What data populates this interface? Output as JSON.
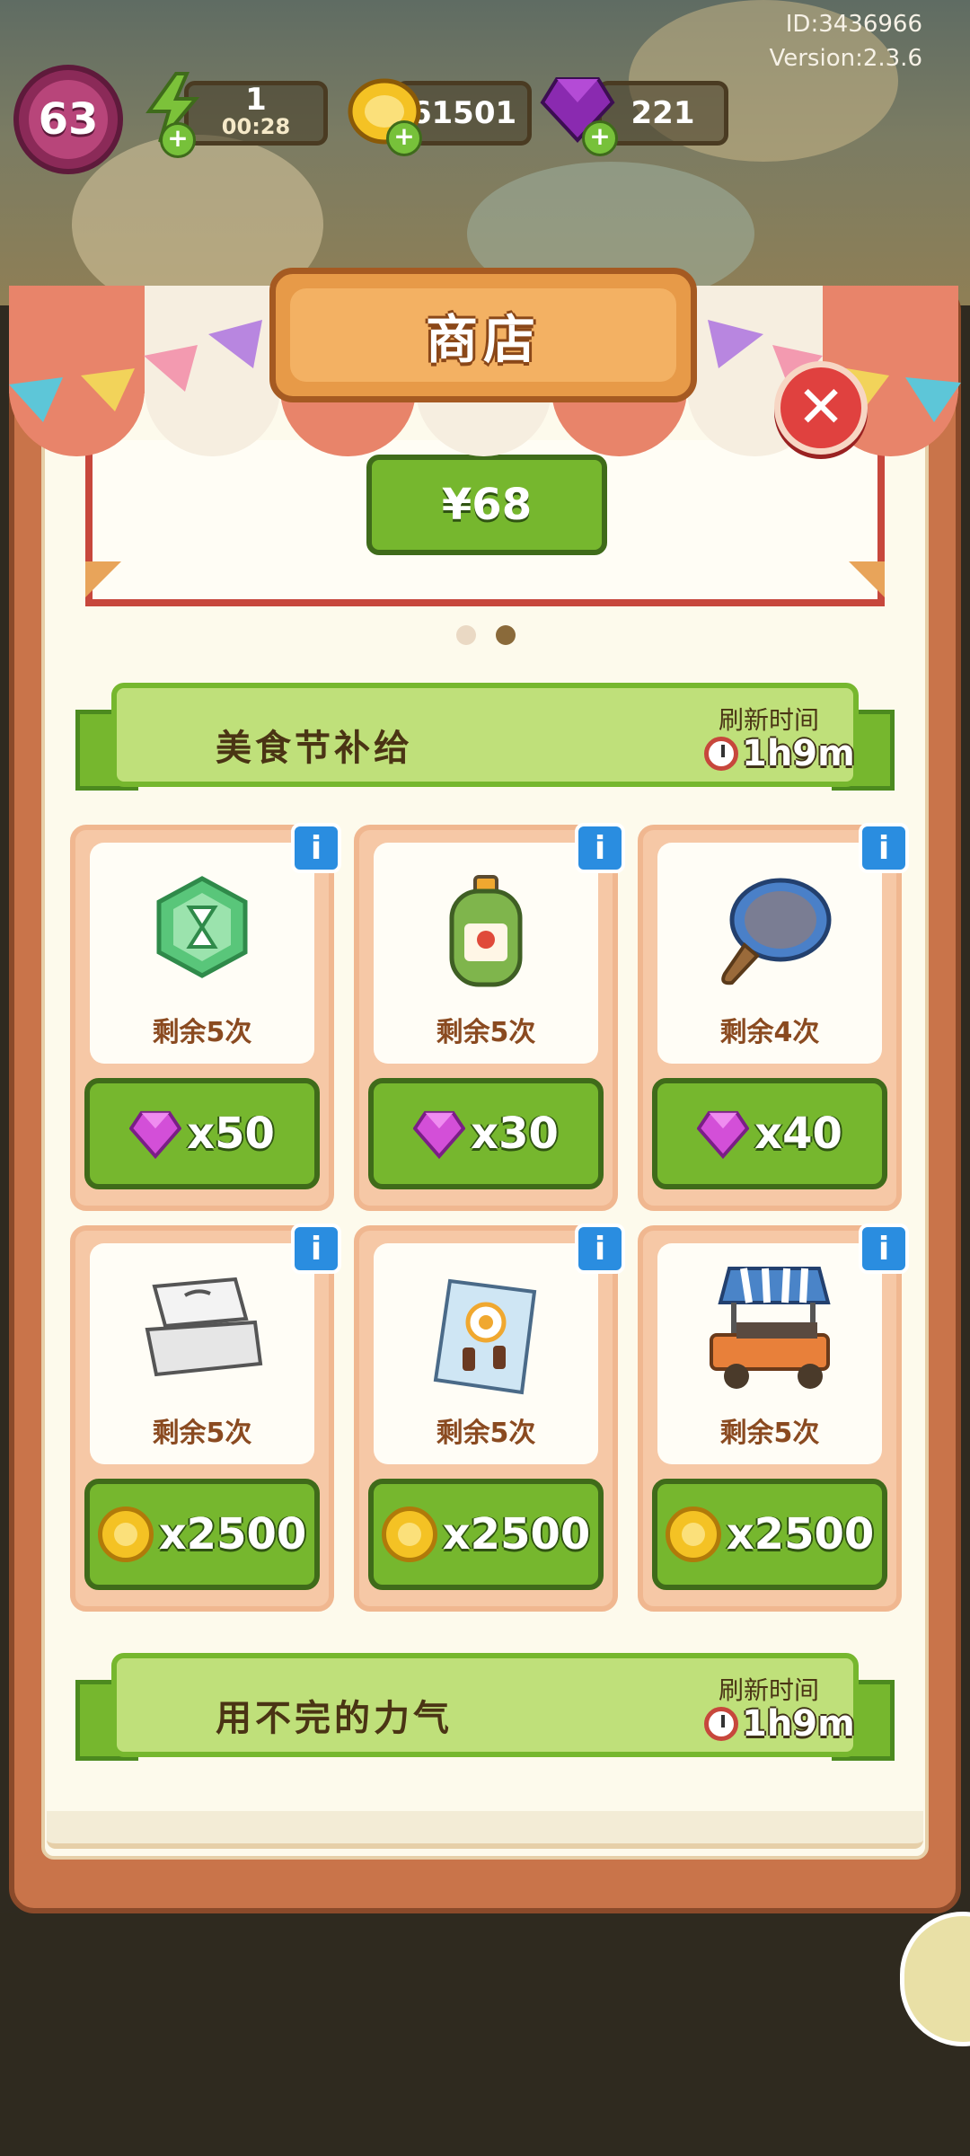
{
  "hud": {
    "player_id": "ID:3436966",
    "version": "Version:2.3.6",
    "level": "63",
    "energy": "1",
    "energy_timer": "00:28",
    "coins": "61501",
    "gems": "221"
  },
  "shop": {
    "title": "商店",
    "bundle_price": "¥68",
    "carousel": {
      "pages": 2,
      "active_index": 1
    }
  },
  "sections": [
    {
      "title": "美食节补给",
      "refresh_label": "刷新时间",
      "refresh_time": "1h9m"
    },
    {
      "title": "用不完的力气",
      "refresh_label": "刷新时间",
      "refresh_time": "1h9m"
    }
  ],
  "items": [
    {
      "icon": "hourglass-hexagon-icon",
      "remaining": "剩余5次",
      "currency": "gem",
      "price": "x50"
    },
    {
      "icon": "gas-cylinder-icon",
      "remaining": "剩余5次",
      "currency": "gem",
      "price": "x30"
    },
    {
      "icon": "frying-pan-icon",
      "remaining": "剩余4次",
      "currency": "gem",
      "price": "x40"
    },
    {
      "icon": "takeout-box-icon",
      "remaining": "剩余5次",
      "currency": "coin",
      "price": "x2500"
    },
    {
      "icon": "snack-bag-icon",
      "remaining": "剩余5次",
      "currency": "coin",
      "price": "x2500"
    },
    {
      "icon": "food-cart-icon",
      "remaining": "剩余5次",
      "currency": "coin",
      "price": "x2500"
    }
  ],
  "colors": {
    "accent_green": "#76b72e",
    "panel_orange": "#c9744a",
    "close_red": "#e0413f",
    "gem_purple": "#c93fd6",
    "coin_gold": "#f4c224"
  }
}
